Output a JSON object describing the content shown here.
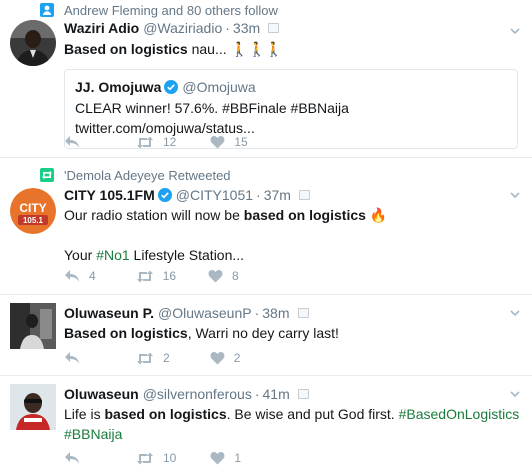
{
  "colors": {
    "accent": "#1da1f2",
    "hashtag": "#1a7b3c",
    "muted": "#657786",
    "icon": "#aab8c2"
  },
  "tweets": [
    {
      "context": {
        "icon": "person-follow-icon",
        "text": "Andrew Fleming and 80 others follow"
      },
      "name": "Waziri Adio",
      "handle": "@Waziriadio",
      "time": "33m",
      "text_bold": "Based on logistics",
      "text_rest": " nau... 🚶🚶🚶",
      "quote": {
        "name": "JJ. Omojuwa",
        "handle": "@Omojuwa",
        "verified": true,
        "text": "CLEAR winner! 57.6%. #BBFinale #BBNaija twitter.com/omojuwa/status..."
      },
      "retweets": "12",
      "likes": "15"
    },
    {
      "context": {
        "icon": "retweet-icon",
        "text": "'Demola Adeyeye Retweeted"
      },
      "name": "CITY 105.1FM",
      "handle": "@CITY1051",
      "verified": true,
      "time": "37m",
      "text_pre": "Our radio station will now be ",
      "text_bold": "based on logistics",
      "text_emoji": " 🔥",
      "text2_pre": "Your ",
      "text2_tag": "#No1",
      "text2_rest": " Lifestyle Station...",
      "replies": "4",
      "retweets": "16",
      "likes": "8",
      "avatar_text": "CITY",
      "avatar_sub": "105.1"
    },
    {
      "name": "Oluwaseun P.",
      "handle": "@OluwaseunP",
      "time": "38m",
      "text_bold": "Based on logistics",
      "text_rest": ", Warri no dey carry last!",
      "retweets": "2",
      "likes": "2"
    },
    {
      "name": "Oluwaseun",
      "handle": "@silvernonferous",
      "time": "41m",
      "text_pre": "Life is ",
      "text_bold": "based on logistics",
      "text_rest": ". Be wise and put God first. ",
      "text_tag1": "#BasedOnLogistics",
      "text_tag2": "#BBNaija",
      "retweets": "10",
      "likes": "1"
    }
  ]
}
